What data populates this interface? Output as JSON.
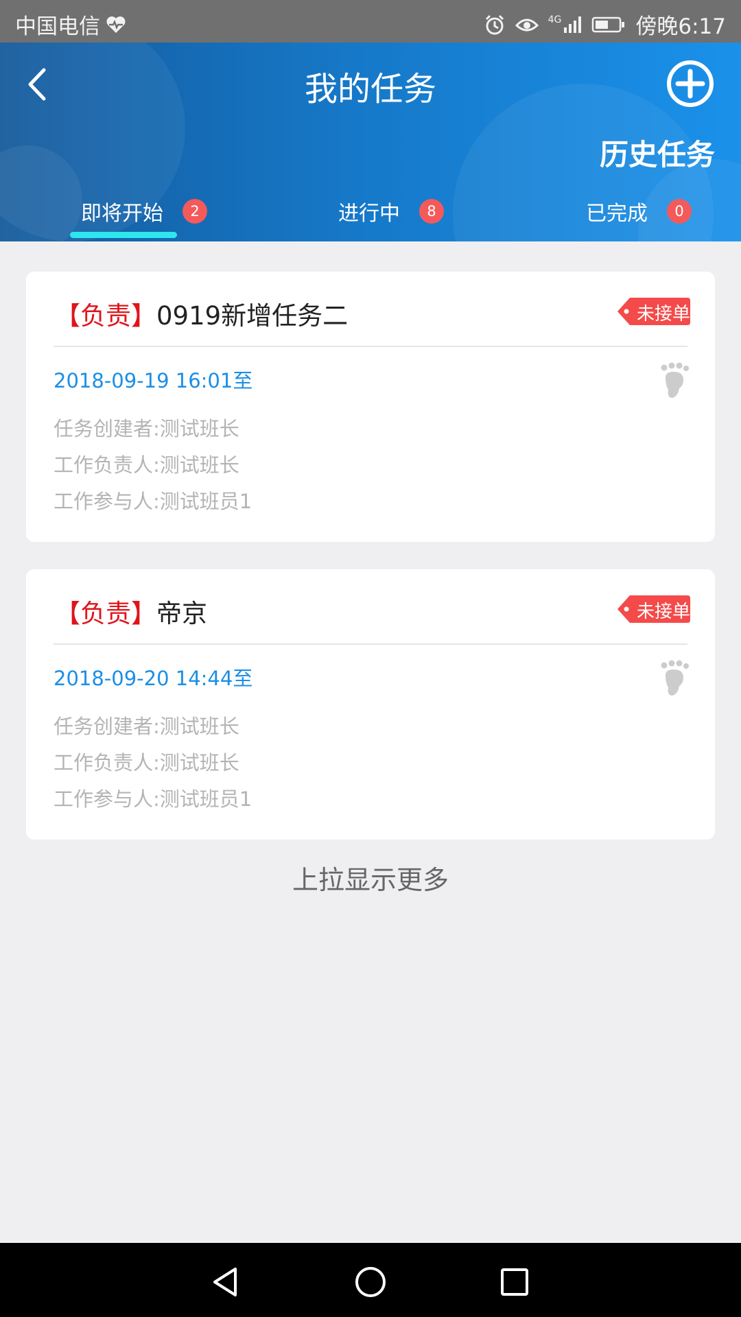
{
  "status_bar": {
    "carrier": "中国电信",
    "network": "4G",
    "time": "傍晚6:17"
  },
  "header": {
    "title": "我的任务",
    "history_label": "历史任务",
    "gradient_colors": [
      "#145a9c",
      "#1a91ea"
    ]
  },
  "tabs": [
    {
      "label": "即将开始",
      "count": "2",
      "active": true
    },
    {
      "label": "进行中",
      "count": "8",
      "active": false
    },
    {
      "label": "已完成",
      "count": "0",
      "active": false
    }
  ],
  "tasks": [
    {
      "role": "【负责】",
      "name": "0919新增任务二",
      "tag": "未接单",
      "time": "2018-09-19 16:01至",
      "creator": "任务创建者:测试班长",
      "owner": "工作负责人:测试班长",
      "participant": "工作参与人:测试班员1"
    },
    {
      "role": "【负责】",
      "name": "帝京",
      "tag": "未接单",
      "time": "2018-09-20 14:44至",
      "creator": "任务创建者:测试班长",
      "owner": "工作负责人:测试班长",
      "participant": "工作参与人:测试班员1"
    }
  ],
  "load_more": "上拉显示更多",
  "colors": {
    "accent_blue": "#1b8fe6",
    "role_red": "#e0141b",
    "badge_red": "#f45a5a",
    "tab_indicator": "#2fe6ee"
  }
}
